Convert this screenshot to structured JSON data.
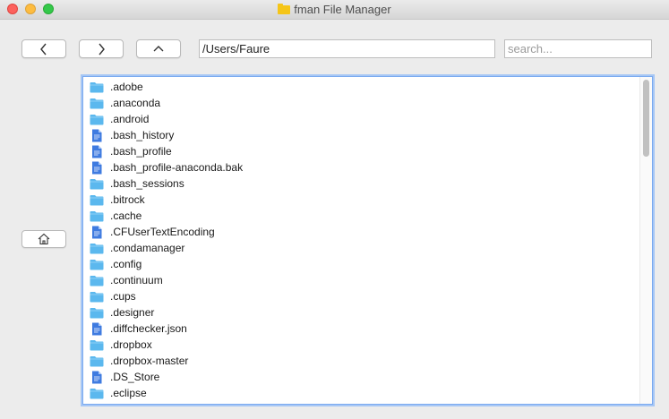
{
  "window": {
    "title": "fman File Manager"
  },
  "toolbar": {
    "back_icon": "chevron-left-icon",
    "forward_icon": "chevron-right-icon",
    "up_icon": "chevron-up-icon",
    "home_icon": "home-icon"
  },
  "path": {
    "value": "/Users/Faure"
  },
  "search": {
    "value": "",
    "placeholder": "search..."
  },
  "files": [
    {
      "name": ".adobe",
      "type": "folder"
    },
    {
      "name": ".anaconda",
      "type": "folder"
    },
    {
      "name": ".android",
      "type": "folder"
    },
    {
      "name": ".bash_history",
      "type": "file"
    },
    {
      "name": ".bash_profile",
      "type": "file"
    },
    {
      "name": ".bash_profile-anaconda.bak",
      "type": "file"
    },
    {
      "name": ".bash_sessions",
      "type": "folder"
    },
    {
      "name": ".bitrock",
      "type": "folder"
    },
    {
      "name": ".cache",
      "type": "folder"
    },
    {
      "name": ".CFUserTextEncoding",
      "type": "file"
    },
    {
      "name": ".condamanager",
      "type": "folder"
    },
    {
      "name": ".config",
      "type": "folder"
    },
    {
      "name": ".continuum",
      "type": "folder"
    },
    {
      "name": ".cups",
      "type": "folder"
    },
    {
      "name": ".designer",
      "type": "folder"
    },
    {
      "name": ".diffchecker.json",
      "type": "file"
    },
    {
      "name": ".dropbox",
      "type": "folder"
    },
    {
      "name": ".dropbox-master",
      "type": "folder"
    },
    {
      "name": ".DS_Store",
      "type": "file"
    },
    {
      "name": ".eclipse",
      "type": "folder"
    }
  ],
  "colors": {
    "folder": "#5bb8ee",
    "file": "#3f7be0",
    "focus": "#7aaaf0"
  }
}
